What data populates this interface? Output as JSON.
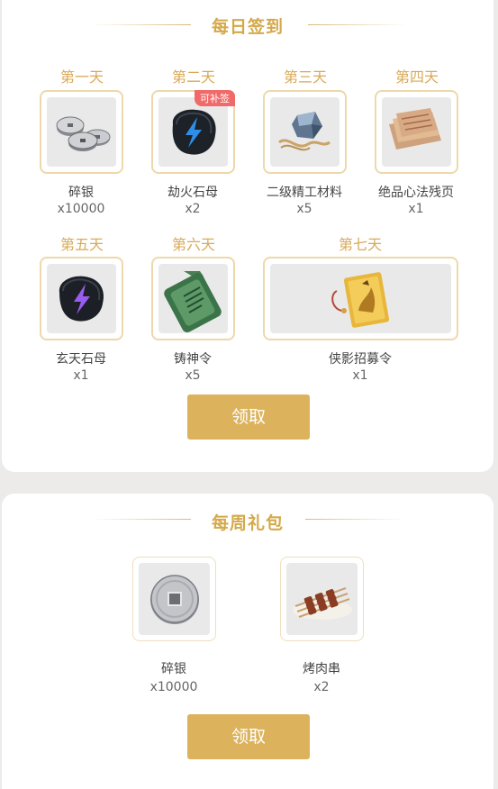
{
  "daily": {
    "title": "每日签到",
    "days": [
      {
        "label": "第一天",
        "name": "碎银",
        "qty": "x10000",
        "icon": "silver-coins-icon"
      },
      {
        "label": "第二天",
        "name": "劫火石母",
        "qty": "x2",
        "icon": "blue-stone-icon",
        "badge": "可补签"
      },
      {
        "label": "第三天",
        "name": "二级精工材料",
        "qty": "x5",
        "icon": "crafting-material-icon"
      },
      {
        "label": "第四天",
        "name": "绝品心法残页",
        "qty": "x1",
        "icon": "scroll-pages-icon"
      },
      {
        "label": "第五天",
        "name": "玄天石母",
        "qty": "x1",
        "icon": "purple-stone-icon"
      },
      {
        "label": "第六天",
        "name": "铸神令",
        "qty": "x5",
        "icon": "jade-token-icon"
      },
      {
        "label": "第七天",
        "name": "侠影招募令",
        "qty": "x1",
        "icon": "recruit-card-icon"
      }
    ],
    "claim_label": "领取"
  },
  "weekly": {
    "title": "每周礼包",
    "items": [
      {
        "name": "碎银",
        "qty": "x10000",
        "icon": "silver-coin-icon"
      },
      {
        "name": "烤肉串",
        "qty": "x2",
        "icon": "kebab-icon"
      }
    ],
    "claim_label": "领取"
  },
  "colors": {
    "accent_gold": "#dcb35c",
    "title_gold": "#d4a94a",
    "badge_red": "#f06a6a",
    "background": "#ecebea"
  }
}
